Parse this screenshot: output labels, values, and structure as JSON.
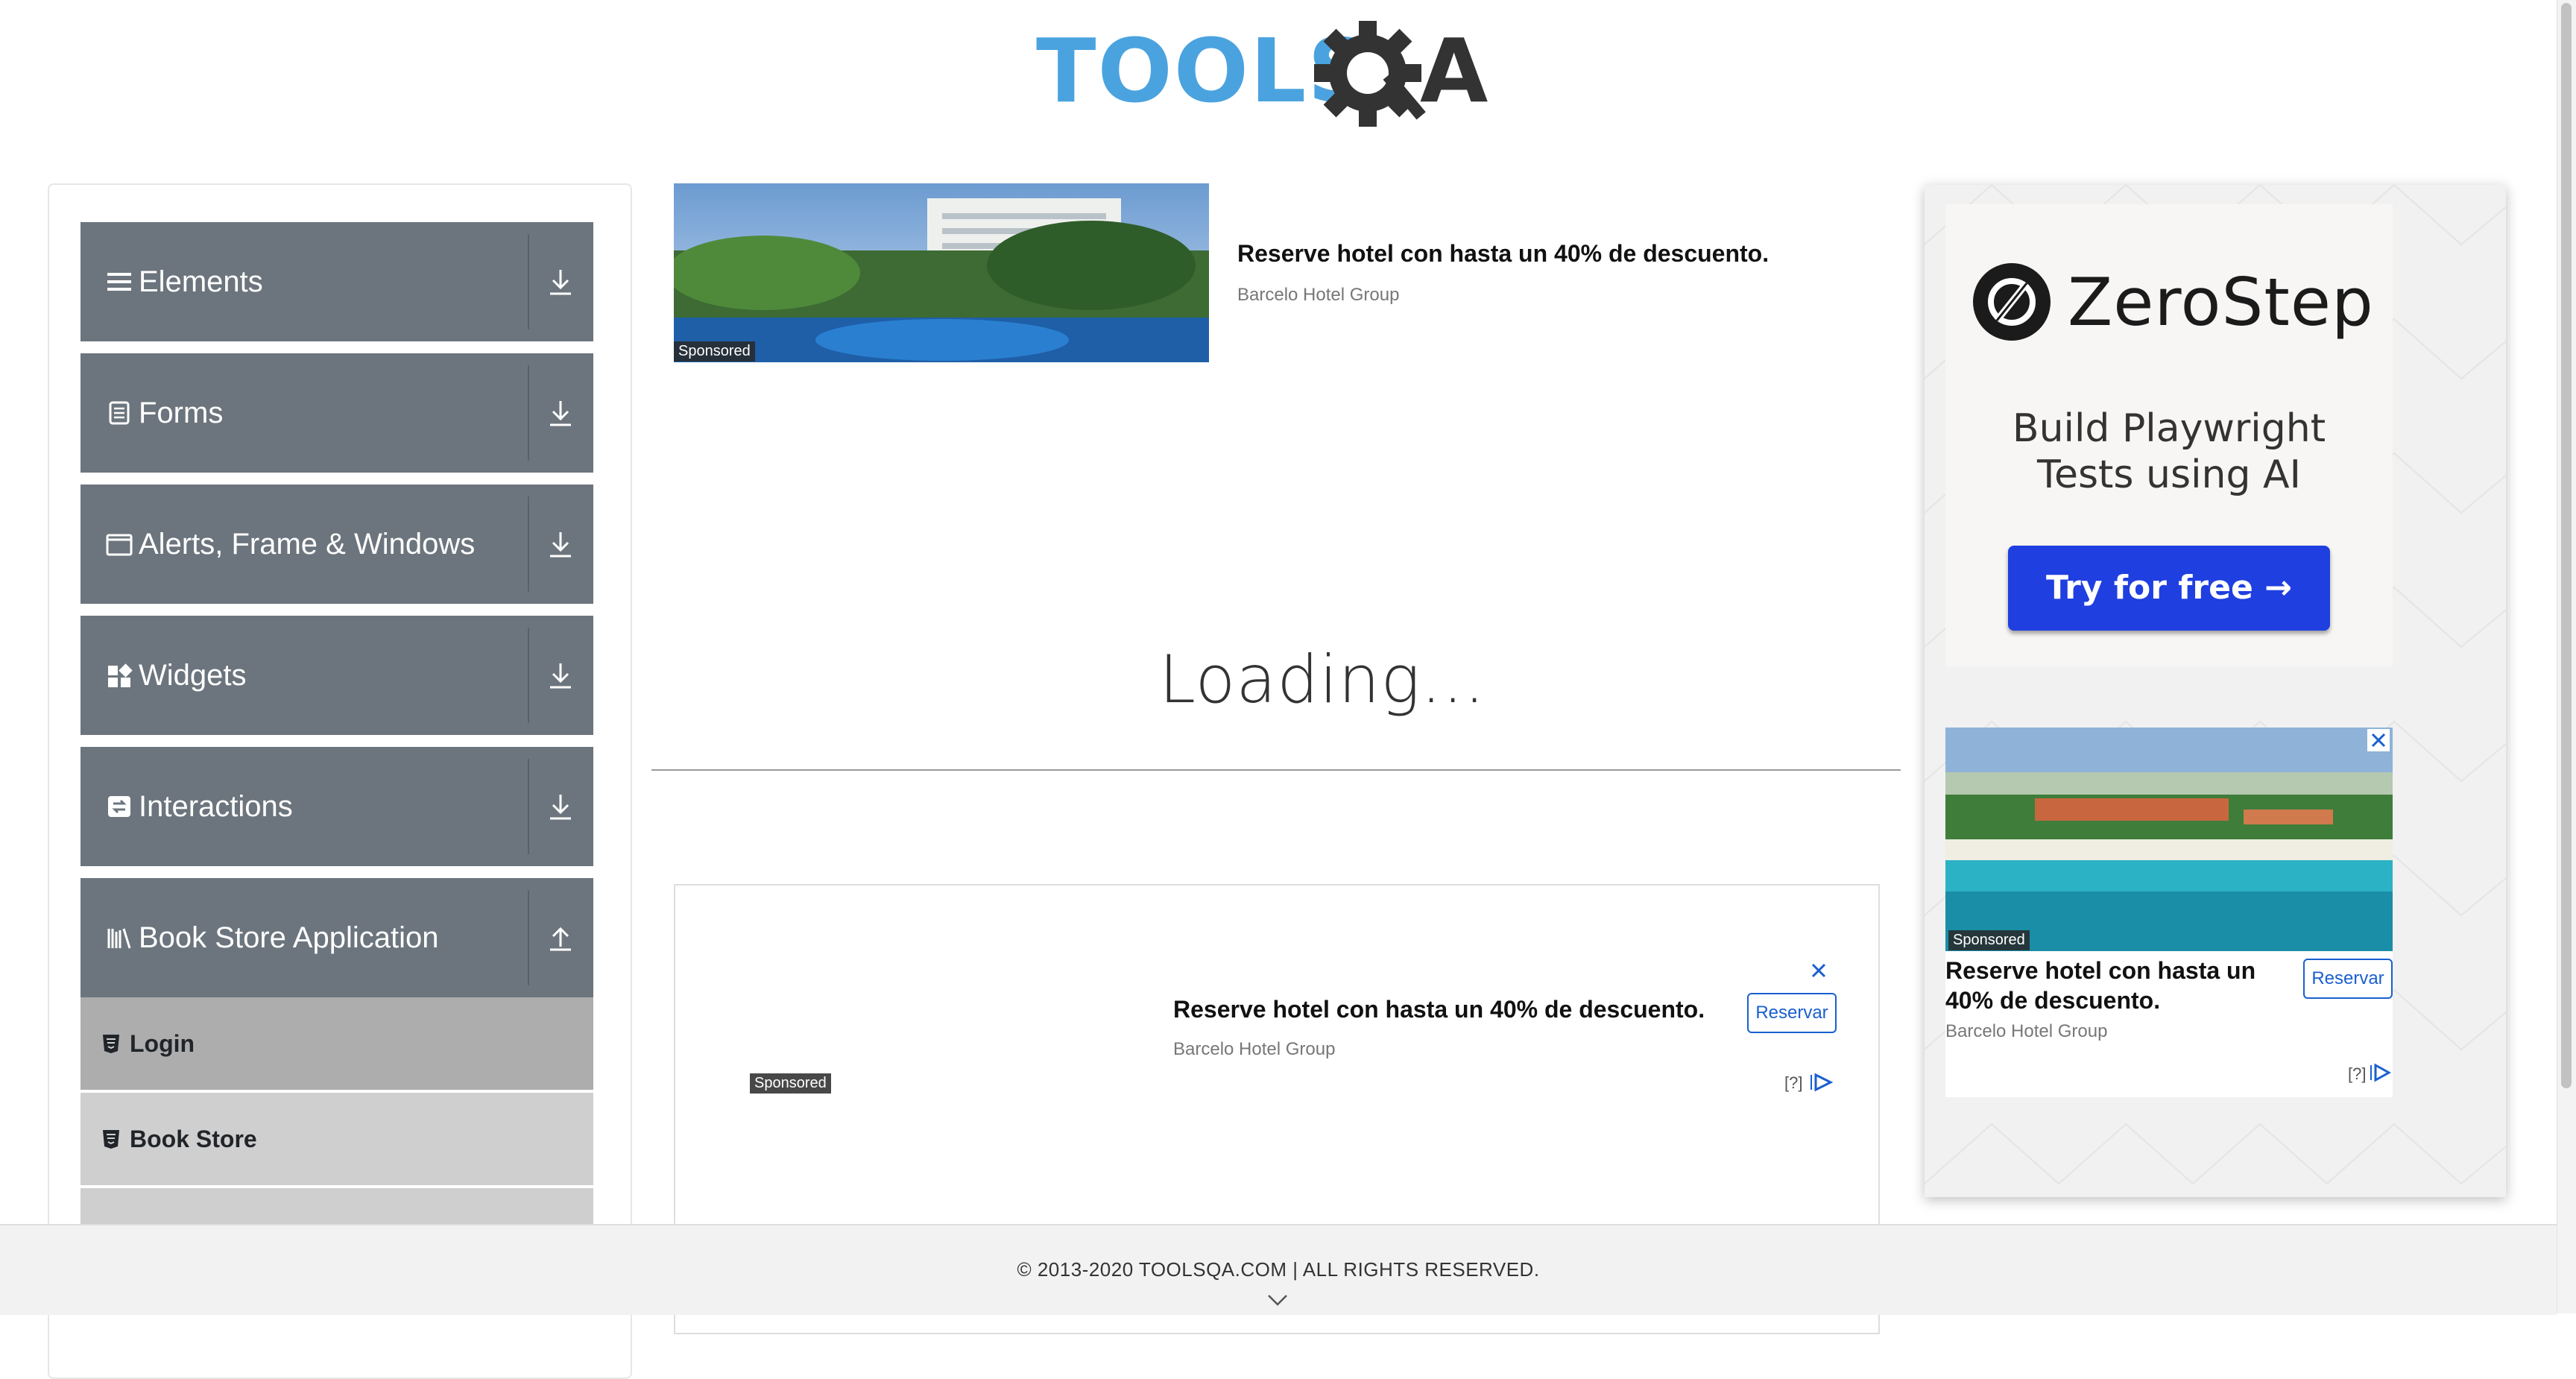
{
  "header": {
    "logo_text": "TOOLSQA",
    "logo_colors": {
      "tools": "#4aa3df",
      "qa": "#333333"
    }
  },
  "sidebar": {
    "groups": [
      {
        "label": "Elements",
        "icon": "hamburger-icon",
        "arrow": "download-icon"
      },
      {
        "label": "Forms",
        "icon": "document-icon",
        "arrow": "download-icon"
      },
      {
        "label": "Alerts, Frame & Windows",
        "icon": "window-icon",
        "arrow": "download-icon"
      },
      {
        "label": "Widgets",
        "icon": "widgets-icon",
        "arrow": "download-icon"
      },
      {
        "label": "Interactions",
        "icon": "interactions-icon",
        "arrow": "download-icon"
      },
      {
        "label": "Book Store Application",
        "icon": "books-icon",
        "arrow": "upload-icon"
      }
    ],
    "items": [
      {
        "label": "Login",
        "icon": "html5-icon",
        "active": true
      },
      {
        "label": "Book Store",
        "icon": "html5-icon",
        "active": false
      }
    ]
  },
  "top_ad": {
    "sponsored": "Sponsored",
    "title": "Reserve hotel con hasta un 40% de descuento.",
    "advertiser": "Barcelo Hotel Group"
  },
  "main": {
    "loading_text": "Loading..."
  },
  "bottom_ad": {
    "title": "Reserve hotel con hasta un 40% de descuento.",
    "advertiser": "Barcelo Hotel Group",
    "button": "Reservar",
    "sponsored": "Sponsored",
    "info": "[?]"
  },
  "right_ad": {
    "brand": "ZeroStep",
    "headline": "Build Playwright Tests using AI",
    "cta": "Try for free →",
    "hotel": {
      "sponsored": "Sponsored",
      "title": "Reserve hotel con hasta un 40% de descuento.",
      "advertiser": "Barcelo Hotel Group",
      "button": "Reservar",
      "info": "[?]"
    }
  },
  "footer": {
    "copyright": "© 2013-2020 TOOLSQA.COM | ALL RIGHTS RESERVED."
  },
  "colors": {
    "sidebar_header": "#6c757d",
    "menu_item": "#cfcfcf",
    "menu_item_active": "#adadad",
    "cta_blue": "#1f3fe0",
    "link_blue": "#1a5fd0"
  }
}
